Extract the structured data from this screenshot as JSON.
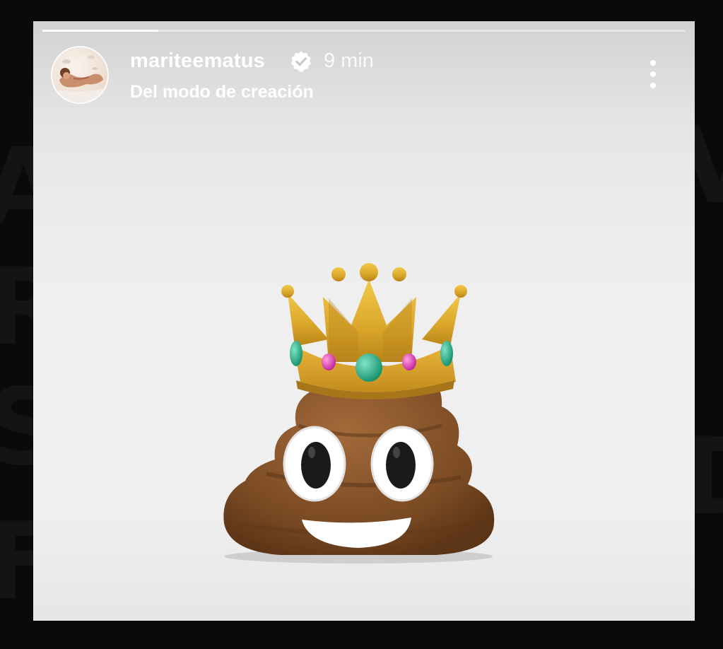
{
  "story": {
    "progress": 0.18,
    "username": "mariteematus",
    "verified": true,
    "time_ago": "9 min",
    "subtitle": "Del modo de creación",
    "sticker": "crowned-poop-emoji"
  },
  "icons": {
    "verified": "verified-badge-icon",
    "menu": "more-options-icon"
  },
  "colors": {
    "background": "#efefef",
    "text": "#ffffff",
    "crown": "#d9a62a",
    "poop": "#7a4a23"
  }
}
